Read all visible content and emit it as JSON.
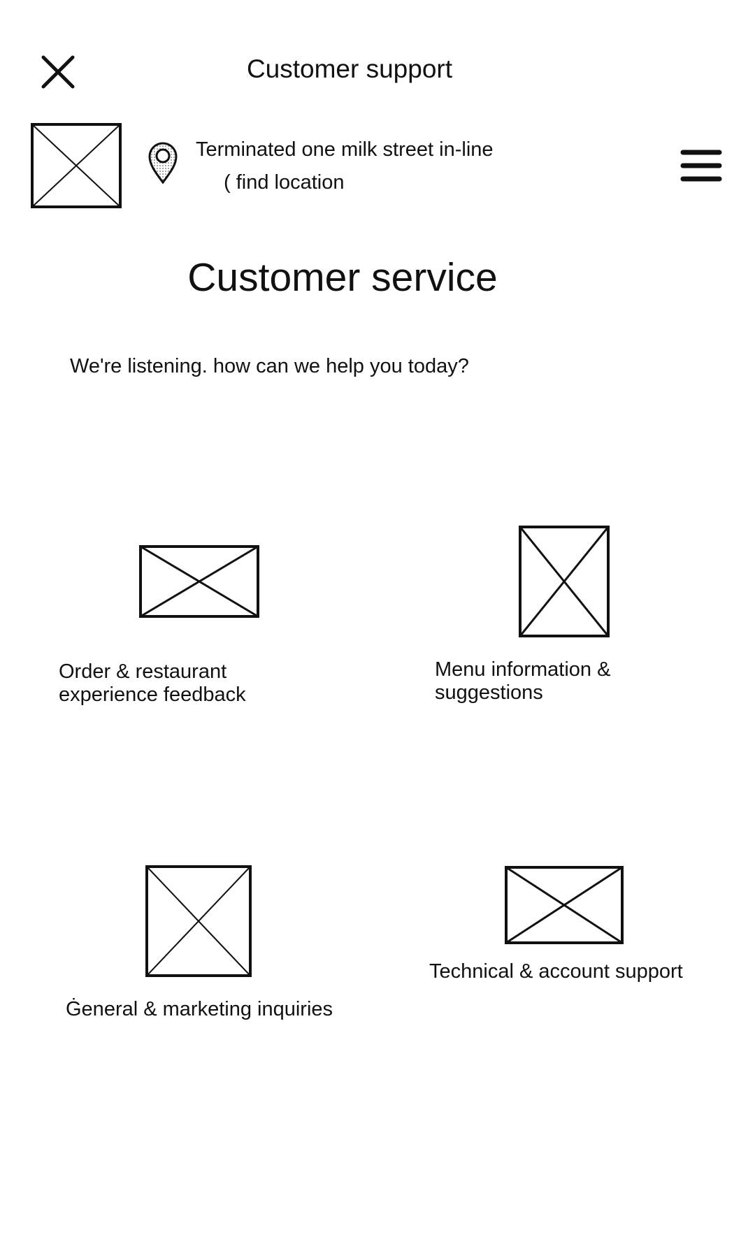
{
  "header": {
    "title": "Customer support",
    "close_icon": "close-icon",
    "menu_icon": "hamburger-menu-icon"
  },
  "location_bar": {
    "logo": "image-placeholder",
    "pin_icon": "location-pin-icon",
    "address": "Terminated one milk street in-line",
    "find_location": "( find location"
  },
  "main": {
    "heading": "Customer service",
    "subtitle": "We're listening. how can we help you today?"
  },
  "categories": [
    {
      "line1": "Order & restaurant",
      "line2": "experience feedback",
      "icon": "image-placeholder"
    },
    {
      "line1": "Menu information &",
      "line2": "suggestions",
      "icon": "image-placeholder"
    },
    {
      "line1": "Ġeneral & marketing inquiries",
      "icon": "image-placeholder"
    },
    {
      "line1": "Technical & account support",
      "icon": "image-placeholder"
    }
  ],
  "colors": {
    "background": "#ffffff",
    "ink": "#111111"
  }
}
